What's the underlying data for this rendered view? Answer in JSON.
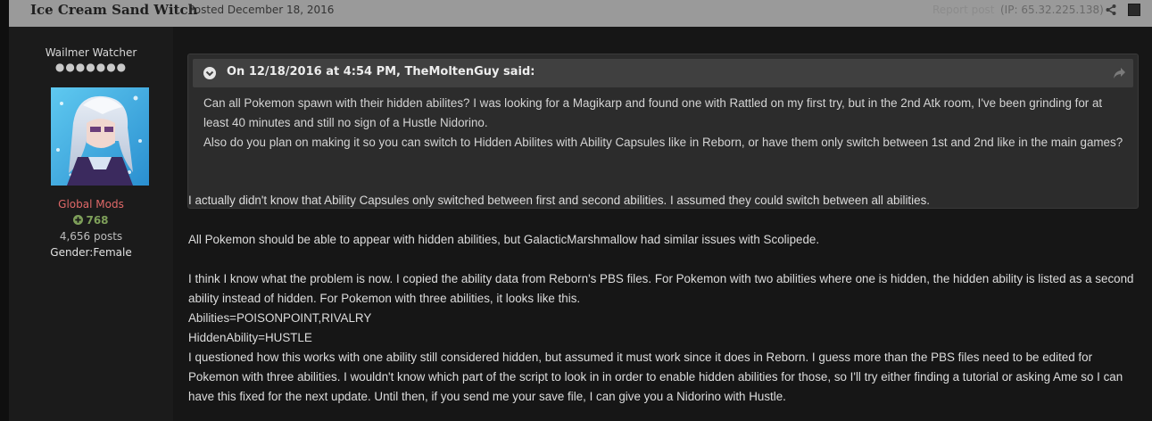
{
  "header": {
    "author": "Ice Cream Sand Witch",
    "posted": "Posted December 18, 2016",
    "report": "Report post",
    "ip": "(IP: 65.32.225.138)"
  },
  "author_panel": {
    "member_title": "Wailmer Watcher",
    "rank_pips": "●●●●●●●",
    "group": "Global Mods",
    "reputation": "768",
    "posts": "4,656 posts",
    "gender": "Gender:Female"
  },
  "quote": {
    "citation": "On 12/18/2016 at 4:54 PM, TheMoltenGuy said:",
    "lines": [
      "Can all Pokemon spawn with their hidden abilites? I was looking for a Magikarp and found one with Rattled on my first try, but in the 2nd Atk room, I've been grinding for at least 40 minutes and still no sign of a Hustle Nidorino.",
      "Also do you plan on making it so you can switch to Hidden Abilites with Ability Capsules like in Reborn, or have them only switch between 1st and 2nd like in the main games?"
    ]
  },
  "post": {
    "paragraph1": "I actually didn't know that Ability Capsules only switched between first and second abilities. I assumed they could switch between all abilities.",
    "paragraph2": "All Pokemon should be able to appear with hidden abilities, but GalacticMarshmallow had similar issues with Scolipede.",
    "paragraph3": "I think I know what the problem is now. I copied the ability data from Reborn's PBS files. For Pokemon with two abilities where one is hidden, the hidden ability is listed as a second ability instead of hidden. For Pokemon with three abilities, it looks like this.",
    "code_line1": "Abilities=POISONPOINT,RIVALRY",
    "code_line2": "HiddenAbility=HUSTLE",
    "paragraph4": "I questioned how this works with one ability still considered hidden, but assumed it must work since it does in Reborn. I guess more than the PBS files need to be edited for Pokemon with three abilities. I wouldn't know which part of the script to look in in order to enable hidden abilities for those, so I'll try either finding a tutorial or asking Ame so I can have this fixed for the next update. Until then, if you send me your save file, I can give you a Nidorino with Hustle."
  },
  "icons": {
    "share": "share-icon",
    "quote_toggle": "chevron-down-circle-icon",
    "quote_link": "share-arrow-icon",
    "reputation": "plus-circle-icon"
  },
  "colors": {
    "group": "#e06868",
    "reputation": "#7fa05a",
    "header_bg": "#9a9a9a",
    "quote_header_bg": "#404040"
  }
}
